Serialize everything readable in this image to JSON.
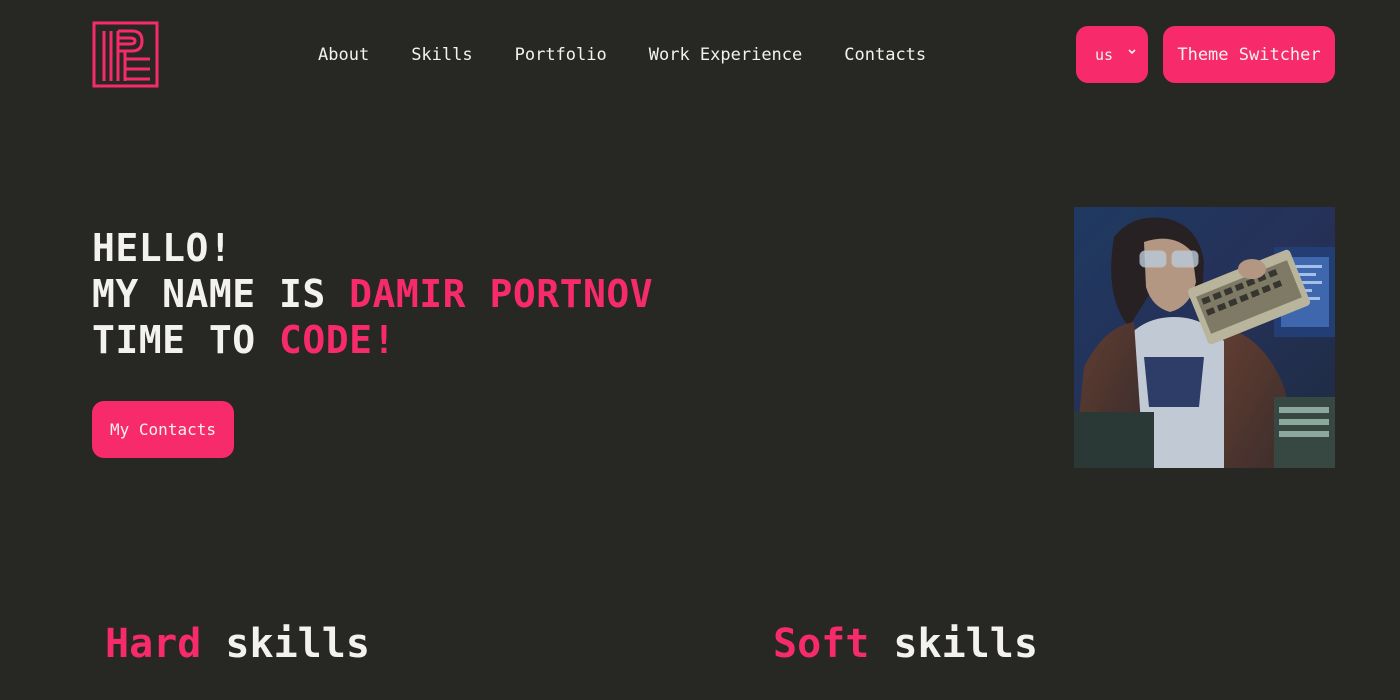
{
  "header": {
    "logo_icon": "logo-dp-icon",
    "nav": [
      {
        "label": "About"
      },
      {
        "label": "Skills"
      },
      {
        "label": "Portfolio"
      },
      {
        "label": "Work Experience"
      },
      {
        "label": "Contacts"
      }
    ],
    "language": {
      "value": "us",
      "icon": "chevron-down-icon"
    },
    "theme_switcher_label": "Theme Switcher"
  },
  "hero": {
    "line1": "HELLO!",
    "line2_prefix": "MY NAME IS ",
    "line2_name": "DAMIR PORTNOV",
    "line3_prefix": "TIME TO ",
    "line3_highlight": "CODE!",
    "contacts_button": "My Contacts",
    "photo": "profile-photo"
  },
  "skills": {
    "hard_accent": "Hard",
    "hard_rest": " skills",
    "soft_accent": "Soft",
    "soft_rest": " skills"
  },
  "colors": {
    "background": "#272723",
    "accent": "#f72b6c",
    "text": "#f4f2ee"
  }
}
